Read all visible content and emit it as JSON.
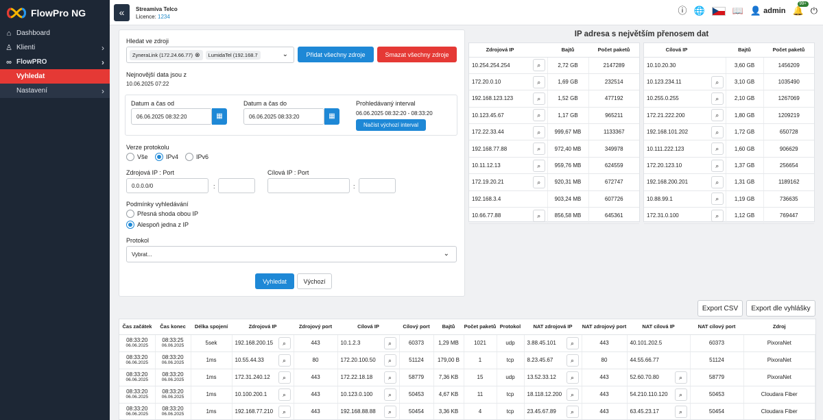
{
  "app": {
    "name": "FlowPro NG"
  },
  "sidebar": {
    "items": [
      {
        "label": "Dashboard",
        "icon": "home-icon"
      },
      {
        "label": "Klienti",
        "icon": "user-icon"
      },
      {
        "label": "FlowPRO",
        "icon": "infinity-icon"
      },
      {
        "label": "Vyhledat"
      },
      {
        "label": "Nastavení"
      }
    ]
  },
  "header": {
    "company": "Streamiva Telco",
    "licence_label": "Licence:",
    "licence_value": "1234",
    "user": "admin",
    "notif_badge": "99+"
  },
  "form": {
    "sources_label": "Hledat ve zdroji",
    "chips": [
      "ZyneraLink (172.24.66.77)",
      "LumidaTel (192.168.7"
    ],
    "add_all": "Přidat všechny zdroje",
    "remove_all": "Smazat všechny zdroje",
    "latest_label": "Nejnovější data jsou z",
    "latest_value": "10.06.2025 07:22",
    "from_label": "Datum a čas od",
    "from_value": "06.06.2025 08:32:20",
    "to_label": "Datum a čas do",
    "to_value": "06.06.2025 08:33:20",
    "interval_label": "Prohledávaný interval",
    "interval_value": "06.06.2025 08:32:20 - 08:33:20",
    "load_default": "Načíst výchozí interval",
    "protocol_version_label": "Verze protokolu",
    "pv_options": [
      "Vše",
      "IPv4",
      "IPv6"
    ],
    "src_ipport_label": "Zdrojová IP : Port",
    "src_ip_value": "0.0.0.0/0",
    "dst_ipport_label": "Cílová IP : Port",
    "conditions_label": "Podmínky vyhledávání",
    "cond_options": [
      "Přesná shoda obou IP",
      "Alespoň jedna z IP"
    ],
    "protocol_label": "Protokol",
    "protocol_value": "Vybrat...",
    "search": "Vyhledat",
    "default": "Výchozí"
  },
  "top": {
    "title": "IP adresa s největším přenosem dat",
    "left_headers": [
      "Zdrojová IP",
      "Bajtů",
      "Počet paketů"
    ],
    "left_rows": [
      [
        "10.254.254.254",
        "2,72 GB",
        "2147289"
      ],
      [
        "172.20.0.10",
        "1,69 GB",
        "232514"
      ],
      [
        "192.168.123.123",
        "1,52 GB",
        "477192"
      ],
      [
        "10.123.45.67",
        "1,17 GB",
        "965211"
      ],
      [
        "172.22.33.44",
        "999,67 MB",
        "1133367"
      ],
      [
        "192.168.77.88",
        "972,40 MB",
        "349978"
      ],
      [
        "10.11.12.13",
        "959,76 MB",
        "624559"
      ],
      [
        "172.19.20.21",
        "920,31 MB",
        "672747"
      ],
      [
        "192.168.3.4",
        "903,24 MB",
        "607726"
      ],
      [
        "10.66.77.88",
        "856,58 MB",
        "645361"
      ]
    ],
    "right_headers": [
      "Cílová IP",
      "Bajtů",
      "Počet paketů"
    ],
    "right_rows": [
      [
        "10.10.20.30",
        "3,60 GB",
        "1456209"
      ],
      [
        "10.123.234.11",
        "3,10 GB",
        "1035490"
      ],
      [
        "10.255.0.255",
        "2,10 GB",
        "1267069"
      ],
      [
        "172.21.222.200",
        "1,80 GB",
        "1209219"
      ],
      [
        "192.168.101.202",
        "1,72 GB",
        "650728"
      ],
      [
        "10.111.222.123",
        "1,60 GB",
        "906629"
      ],
      [
        "172.20.123.10",
        "1,37 GB",
        "256654"
      ],
      [
        "192.168.200.201",
        "1,31 GB",
        "1189162"
      ],
      [
        "10.88.99.1",
        "1,19 GB",
        "736635"
      ],
      [
        "172.31.0.100",
        "1,12 GB",
        "769447"
      ]
    ]
  },
  "export": {
    "csv": "Export CSV",
    "filtered": "Export dle vyhlášky"
  },
  "results": {
    "headers": [
      "Čas začátek",
      "Čas konec",
      "Délka spojení",
      "Zdrojová IP",
      "Zdrojový port",
      "Cílová IP",
      "Cílový port",
      "Bajtů",
      "Počet paketů",
      "Protokol",
      "NAT zdrojová IP",
      "NAT zdrojový port",
      "NAT cílová IP",
      "NAT cílový port",
      "Zdroj"
    ],
    "rows": [
      {
        "start_t": "08:33:20",
        "start_d": "06.06.2025",
        "end_t": "08:33:25",
        "end_d": "06.06.2025",
        "dur": "5sek",
        "sip": "192.168.200.15",
        "sport": "443",
        "dip": "10.1.2.3",
        "dport": "60373",
        "bytes": "1,29 MB",
        "pkts": "1021",
        "proto": "udp",
        "nsip": "3.88.45.101",
        "nsport": "443",
        "ndip": "40.101.202.5",
        "ndport": "60373",
        "src": "PixoraNet"
      },
      {
        "start_t": "08:33:20",
        "start_d": "06.06.2025",
        "end_t": "08:33:20",
        "end_d": "06.06.2025",
        "dur": "1ms",
        "sip": "10.55.44.33",
        "sport": "80",
        "dip": "172.20.100.50",
        "dport": "51124",
        "bytes": "179,00 B",
        "pkts": "1",
        "proto": "tcp",
        "nsip": "8.23.45.67",
        "nsport": "80",
        "ndip": "44.55.66.77",
        "ndport": "51124",
        "src": "PixoraNet"
      },
      {
        "start_t": "08:33:20",
        "start_d": "06.06.2025",
        "end_t": "08:33:20",
        "end_d": "06.06.2025",
        "dur": "1ms",
        "sip": "172.31.240.12",
        "sport": "443",
        "dip": "172.22.18.18",
        "dport": "58779",
        "bytes": "7,36 KB",
        "pkts": "15",
        "proto": "udp",
        "nsip": "13.52.33.12",
        "nsport": "443",
        "ndip": "52.60.70.80",
        "ndport": "58779",
        "src": "PixoraNet"
      },
      {
        "start_t": "08:33:20",
        "start_d": "06.06.2025",
        "end_t": "08:33:20",
        "end_d": "06.06.2025",
        "dur": "1ms",
        "sip": "10.100.200.1",
        "sport": "443",
        "dip": "10.123.0.100",
        "dport": "50453",
        "bytes": "4,67 KB",
        "pkts": "11",
        "proto": "tcp",
        "nsip": "18.118.12.200",
        "nsport": "443",
        "ndip": "54.210.110.120",
        "ndport": "50453",
        "src": "Cloudara Fiber"
      },
      {
        "start_t": "08:33:20",
        "start_d": "06.06.2025",
        "end_t": "08:33:20",
        "end_d": "06.06.2025",
        "dur": "1ms",
        "sip": "192.168.77.210",
        "sport": "443",
        "dip": "192.168.88.88",
        "dport": "50454",
        "bytes": "3,36 KB",
        "pkts": "4",
        "proto": "tcp",
        "nsip": "23.45.67.89",
        "nsport": "443",
        "ndip": "63.45.23.17",
        "ndport": "50454",
        "src": "Cloudara Fiber"
      }
    ]
  }
}
